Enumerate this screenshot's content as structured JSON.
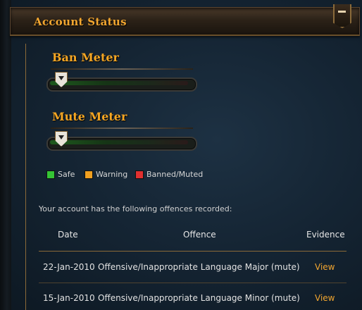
{
  "panel": {
    "title": "Account Status",
    "collapse_label": "–"
  },
  "meters": [
    {
      "title": "Ban Meter",
      "level": 0.0
    },
    {
      "title": "Mute Meter",
      "level": 0.0
    }
  ],
  "legend": [
    {
      "label": "Safe",
      "color": "#35c435"
    },
    {
      "label": "Warning",
      "color": "#f0a020"
    },
    {
      "label": "Banned/Muted",
      "color": "#e03030"
    }
  ],
  "offences": {
    "intro": "Your account has the following offences recorded:",
    "columns": [
      "Date",
      "Offence",
      "Evidence"
    ],
    "rows": [
      {
        "date": "22-Jan-2010",
        "offence": "Offensive/Inappropriate Language Major (mute)",
        "evidence": "View"
      },
      {
        "date": "15-Jan-2010",
        "offence": "Offensive/Inappropriate Language Minor (mute)",
        "evidence": "View"
      }
    ]
  },
  "colors": {
    "accent": "#f2a630",
    "background": "#152534",
    "rule": "#8c6a38"
  }
}
